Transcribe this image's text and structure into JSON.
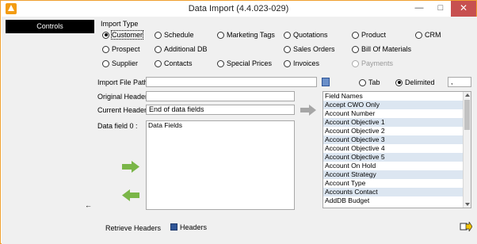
{
  "window": {
    "title": "Data Import (4.4.023-029)",
    "min_glyph": "—",
    "max_glyph": "□",
    "close_glyph": "✕"
  },
  "sidebar": {
    "controls_label": "Controls",
    "back_arrow_glyph": "←"
  },
  "import_type": {
    "label": "Import Type",
    "options": [
      {
        "label": "Customer",
        "checked": true
      },
      {
        "label": "Schedule",
        "checked": false
      },
      {
        "label": "Marketing Tags",
        "checked": false
      },
      {
        "label": "Quotations",
        "checked": false
      },
      {
        "label": "Product",
        "checked": false
      },
      {
        "label": "CRM",
        "checked": false
      },
      {
        "label": "Prospect",
        "checked": false
      },
      {
        "label": "Additional DB",
        "checked": false
      },
      {
        "label": "Sales Orders",
        "checked": false
      },
      {
        "label": "Bill Of Materials",
        "checked": false
      },
      {
        "label": "Supplier",
        "checked": false
      },
      {
        "label": "Contacts",
        "checked": false
      },
      {
        "label": "Special Prices",
        "checked": false
      },
      {
        "label": "Invoices",
        "checked": false
      },
      {
        "label": "Payments",
        "checked": false,
        "disabled": true
      }
    ]
  },
  "file": {
    "path_label": "Import File Path:",
    "path_value": "",
    "tab_label": "Tab",
    "delimited_label": "Delimited",
    "delimiter_value": ","
  },
  "headers": {
    "original_label": "Original Header:",
    "original_value": "",
    "current_label": "Current Header:",
    "current_value": "End of data fields",
    "data_field_label": "Data field 0 :"
  },
  "data_fields": {
    "header": "Data Fields"
  },
  "field_names": {
    "header": "Field Names",
    "items": [
      "Accept CWO Only",
      "Account Number",
      "Account Objective 1",
      "Account Objective 2",
      "Account Objective 3",
      "Account Objective 4",
      "Account Objective 5",
      "Account On Hold",
      "Account Strategy",
      "Account Type",
      "Accounts Contact",
      "AddDB Budget"
    ]
  },
  "footer": {
    "retrieve_headers": "Retrieve Headers",
    "headers": "Headers"
  },
  "colors": {
    "accent": "#f39c12",
    "list_alt": "#dce6f1",
    "arrow_green": "#7ab648",
    "close_red": "#c75050"
  }
}
